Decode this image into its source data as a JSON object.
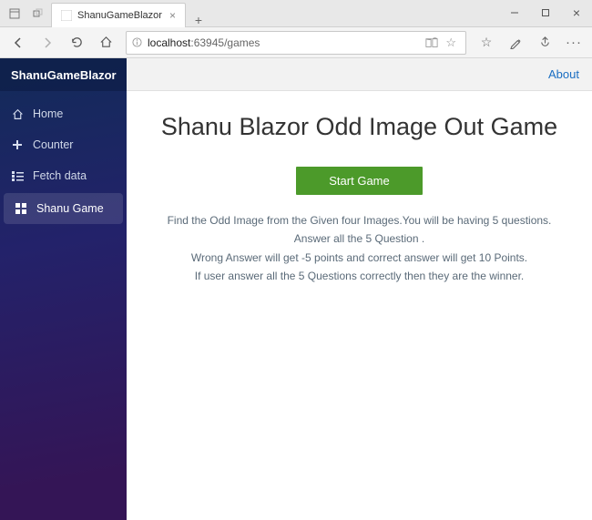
{
  "browser": {
    "tab_title": "ShanuGameBlazor",
    "url_host": "localhost",
    "url_path": ":63945/games"
  },
  "app": {
    "brand": "ShanuGameBlazor",
    "about_label": "About"
  },
  "sidebar": {
    "items": [
      {
        "label": "Home"
      },
      {
        "label": "Counter"
      },
      {
        "label": "Fetch data"
      },
      {
        "label": "Shanu Game"
      }
    ]
  },
  "page": {
    "title": "Shanu Blazor Odd Image Out Game",
    "start_button": "Start Game",
    "instructions": {
      "line1": "Find the Odd Image from the Given four Images.You will be having 5 questions.",
      "line2": "Answer all the 5 Question .",
      "line3": "Wrong Answer will get -5 points and correct answer will get 10 Points.",
      "line4": "If user answer all the 5 Questions correctly then they are the winner."
    }
  }
}
